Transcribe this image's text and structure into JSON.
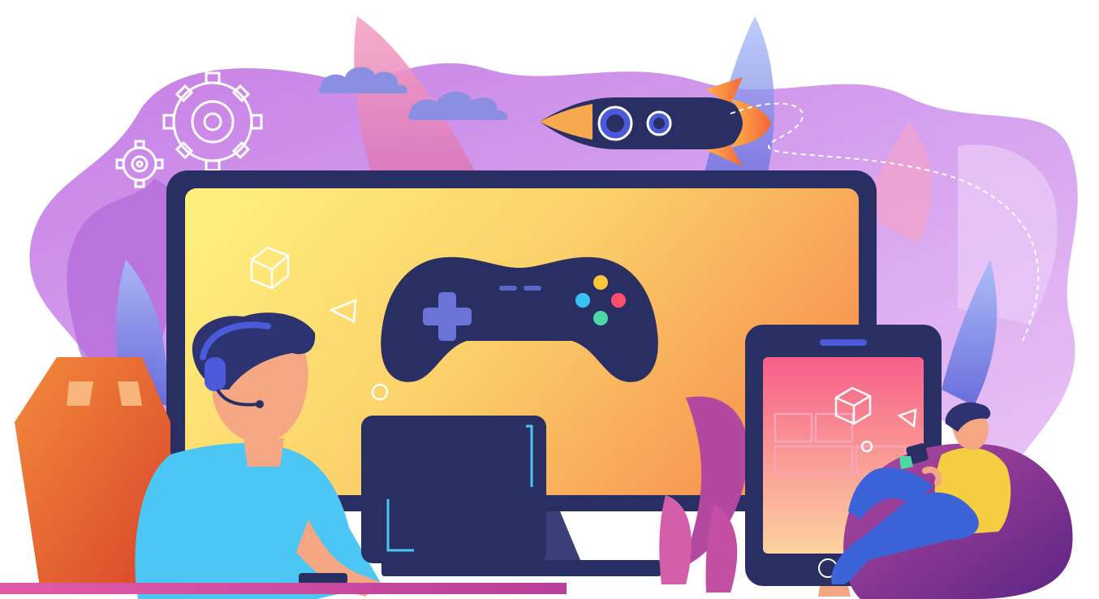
{
  "illustration": {
    "palette": {
      "background": "#ffffff",
      "blob_light": "#e3b8f2",
      "blob_mid": "#c98bea",
      "blob_deep": "#9a6fe0",
      "leaf_pink": "#f0a8c8",
      "leaf_blue": "#7a88e6",
      "navy": "#2a2f63",
      "screen_yellow": "#fff07a",
      "screen_orange": "#f7a94f",
      "tablet_pink": "#f7798f",
      "tablet_peach": "#fbd3a3",
      "shirt_cyan": "#4cc7f5",
      "chair_orange": "#ea5a2e",
      "beanbag_purple": "#6e2a8a",
      "shirt_yellow": "#f5cd41",
      "jeans_blue": "#3c63d8",
      "skin": "#f5a784",
      "hair": "#2c3370",
      "btn_red": "#ff4f6d",
      "btn_yellow": "#ffc53d",
      "btn_green": "#4bd8a5",
      "btn_cyan": "#37c3f4",
      "desk_pink": "#d94ea2"
    },
    "elements": [
      "purple-blob-background",
      "gear-icons",
      "clouds",
      "rocket",
      "monitor",
      "gamepad",
      "tablet",
      "gamer-with-headset",
      "gamer-on-beanbag",
      "desktop-tower",
      "office-chair",
      "plant-leaves",
      "dashed-connection-lines"
    ]
  }
}
